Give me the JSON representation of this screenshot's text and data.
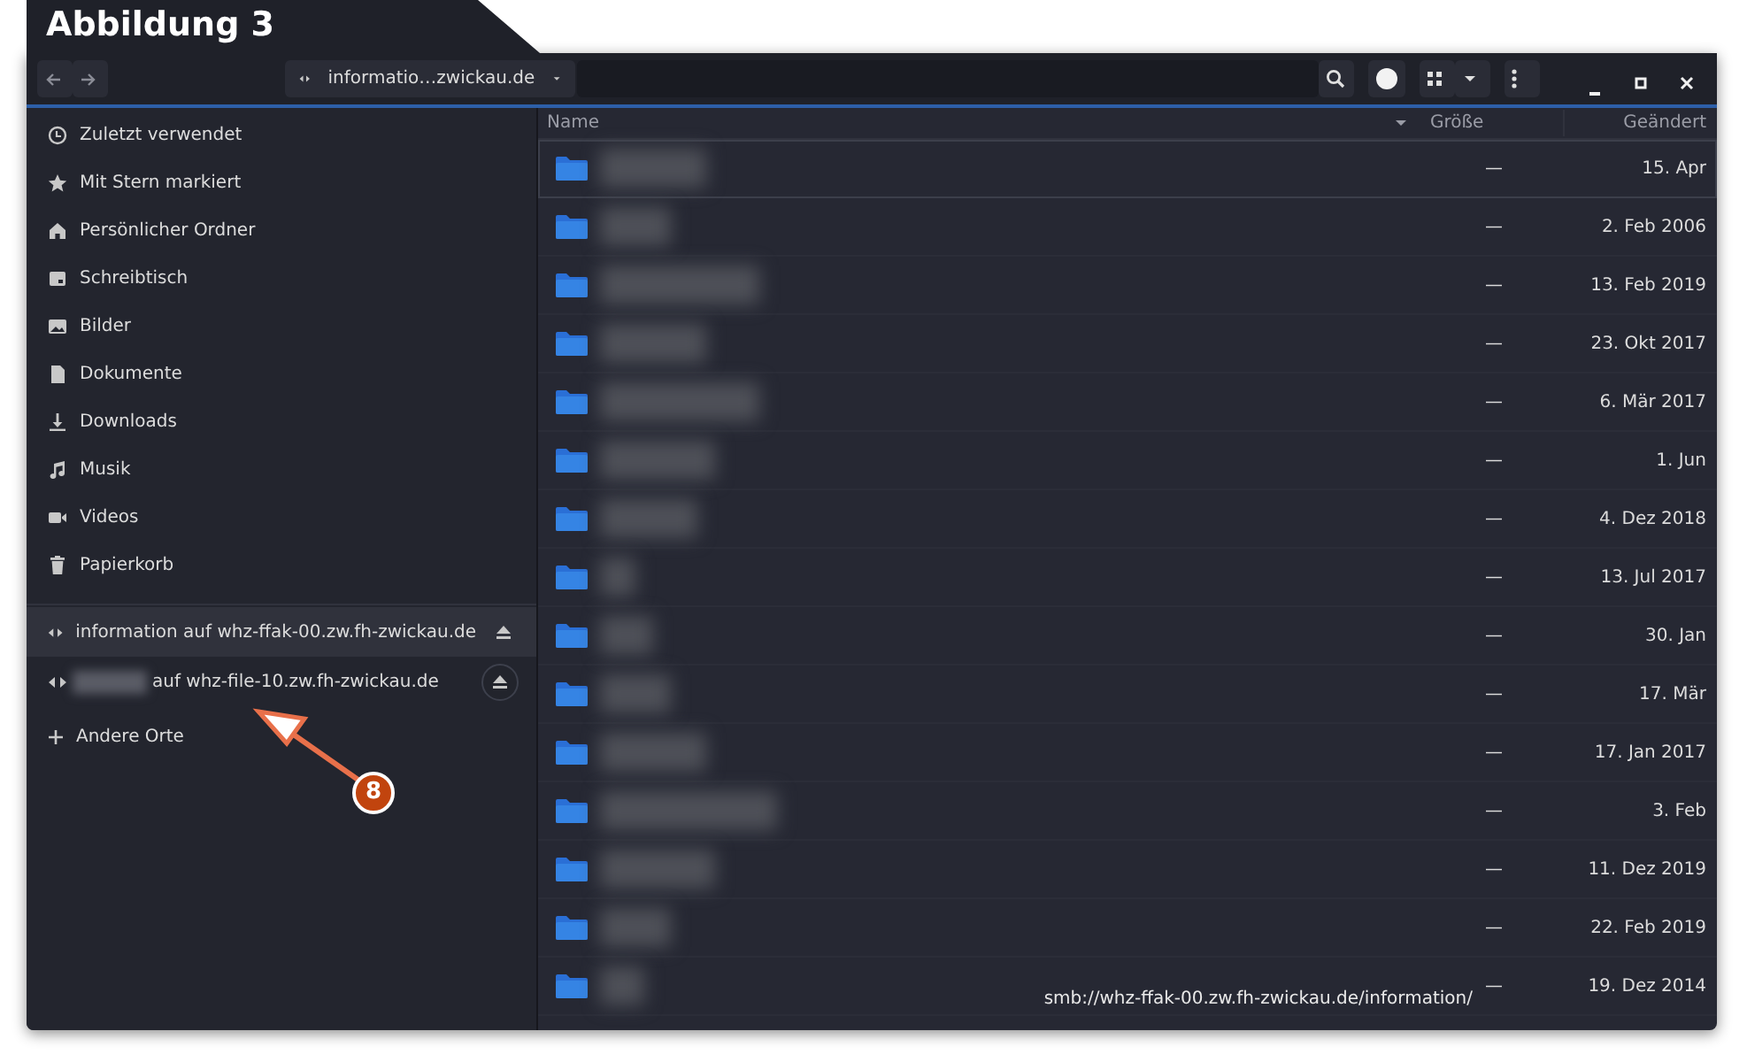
{
  "figure_label": "Abbildung 3",
  "toolbar": {
    "location": "informatio…zwickau.de"
  },
  "sidebar": {
    "places": [
      {
        "kind": "recent",
        "label": "Zuletzt verwendet"
      },
      {
        "kind": "starred",
        "label": "Mit Stern markiert"
      },
      {
        "kind": "home",
        "label": "Persönlicher Ordner"
      },
      {
        "kind": "desktop",
        "label": "Schreibtisch"
      },
      {
        "kind": "pictures",
        "label": "Bilder"
      },
      {
        "kind": "documents",
        "label": "Dokumente"
      },
      {
        "kind": "downloads",
        "label": "Downloads"
      },
      {
        "kind": "music",
        "label": "Musik"
      },
      {
        "kind": "videos",
        "label": "Videos"
      },
      {
        "kind": "trash",
        "label": "Papierkorb"
      }
    ],
    "mounts": [
      {
        "label": "information auf whz-ffak-00.zw.fh-zwickau.de",
        "redacted_prefix": false,
        "selected": true,
        "hovered": false
      },
      {
        "label": "auf whz-file-10.zw.fh-zwickau.de",
        "redacted_prefix": true,
        "selected": false,
        "hovered": true
      }
    ],
    "other": "Andere Orte"
  },
  "columns": [
    {
      "label": "Name",
      "sorted": true
    },
    {
      "label": "Größe",
      "sorted": false
    },
    {
      "label": "Geändert",
      "sorted": false
    }
  ],
  "rows": [
    {
      "size": "—",
      "modified": "15. Apr",
      "focused": true
    },
    {
      "size": "—",
      "modified": "2. Feb 2006",
      "focused": false
    },
    {
      "size": "—",
      "modified": "13. Feb 2019",
      "focused": false
    },
    {
      "size": "—",
      "modified": "23. Okt 2017",
      "focused": false
    },
    {
      "size": "—",
      "modified": "6. Mär 2017",
      "focused": false
    },
    {
      "size": "—",
      "modified": "1. Jun",
      "focused": false
    },
    {
      "size": "—",
      "modified": "4. Dez 2018",
      "focused": false
    },
    {
      "size": "—",
      "modified": "13. Jul 2017",
      "focused": false
    },
    {
      "size": "—",
      "modified": "30. Jan",
      "focused": false
    },
    {
      "size": "—",
      "modified": "17. Mär",
      "focused": false
    },
    {
      "size": "—",
      "modified": "17. Jan 2017",
      "focused": false
    },
    {
      "size": "—",
      "modified": "3. Feb",
      "focused": false
    },
    {
      "size": "—",
      "modified": "11. Dez 2019",
      "focused": false
    },
    {
      "size": "—",
      "modified": "22. Feb 2019",
      "focused": false
    },
    {
      "size": "—",
      "modified": "19. Dez 2014",
      "focused": false
    }
  ],
  "status_url": "smb://whz-ffak-00.zw.fh-zwickau.de/information/",
  "annotation": {
    "label": "8"
  }
}
